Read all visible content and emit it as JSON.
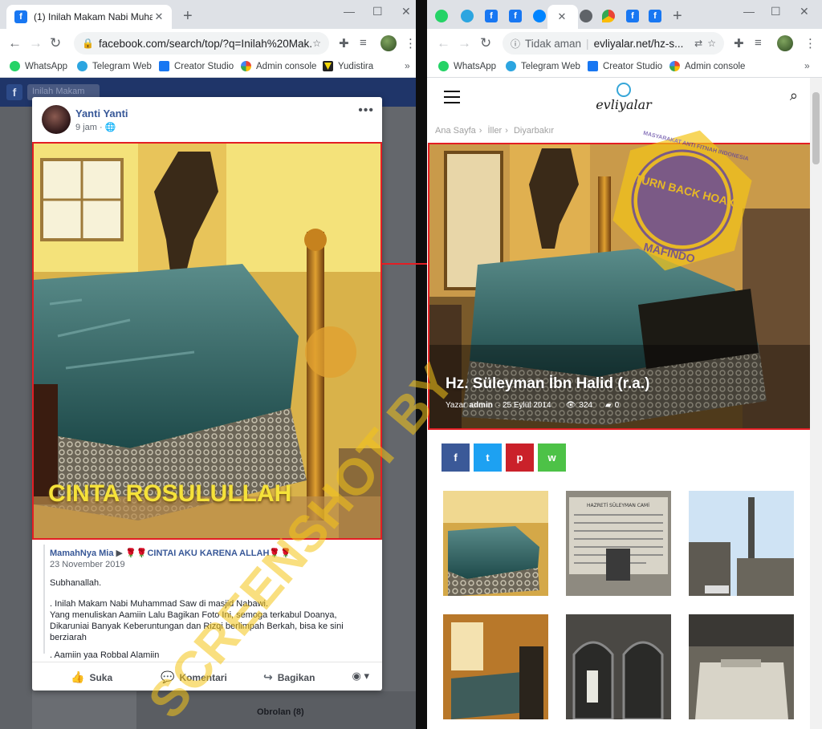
{
  "left_window": {
    "tab": {
      "title": "(1) Inilah Makam Nabi Muhammad"
    },
    "url": "facebook.com/search/top/?q=Inilah%20Mak...",
    "bookmarks": [
      "WhatsApp",
      "Telegram Web",
      "Creator Studio",
      "Admin console",
      "Yudistira"
    ],
    "fb_page": {
      "search_value": "Inilah Makam",
      "obrolan": "Obrolan (8)",
      "post": {
        "author": "Yanti Yanti",
        "time": "9 jam",
        "photo_caption": "CINTA ROSULULLAH",
        "shared": {
          "author": "MamahNya Mia",
          "feeling": "CINTAI AKU KARENA ALLAH",
          "date": "23 November 2019",
          "p1": "Subhanallah.",
          "p2": ". Inilah Makam Nabi Muhammad Saw di masjid Nabawi.",
          "p3": "Yang menuliskan Aamiin Lalu Bagikan Foto Ini, semoga terkabul Doanya, Dikaruniai Banyak Keberuntungan dan Rizqi berlimpah Berkah, bisa ke sini berziarah",
          "p4": ". Aamiin yaa Robbal Alamiin"
        },
        "actions": {
          "like": "Suka",
          "comment": "Komentari",
          "share": "Bagikan"
        }
      }
    }
  },
  "right_window": {
    "url_prefix": "Tidak aman",
    "url": "evliyalar.net/hz-s...",
    "bookmarks": [
      "WhatsApp",
      "Telegram Web",
      "Creator Studio",
      "Admin console"
    ],
    "site": {
      "logo": "evliyalar",
      "breadcrumb": [
        "Ana Sayfa",
        "İller",
        "Diyarbakır"
      ],
      "article": {
        "title": "Hz. Süleyman İbn Halid (r.a.)",
        "author_label": "Yazar",
        "author": "admin",
        "date": "25 Eylül 2014",
        "views": "324",
        "comments": "0"
      },
      "share_buttons": [
        {
          "icon": "facebook-icon",
          "glyph": "f",
          "color": "#3b5998"
        },
        {
          "icon": "twitter-icon",
          "glyph": "t",
          "color": "#1da1f2"
        },
        {
          "icon": "pinterest-icon",
          "glyph": "p",
          "color": "#ca212a"
        },
        {
          "icon": "whatsapp-icon",
          "glyph": "w",
          "color": "#4dc247"
        }
      ],
      "plaque_text": "HAZRETİ SÜLEYMAN CAMİ"
    }
  },
  "watermark": {
    "text": "SCREENSHOT BY",
    "stamp_top": "TURN BACK HOAX",
    "stamp_ring": "MASYARAKAT ANTI FITNAH INDONESIA",
    "stamp_bottom": "MAFINDO"
  },
  "colors": {
    "highlight_red": "#e31e24",
    "fb_blue": "#385898",
    "watermark": "#f5c518"
  }
}
